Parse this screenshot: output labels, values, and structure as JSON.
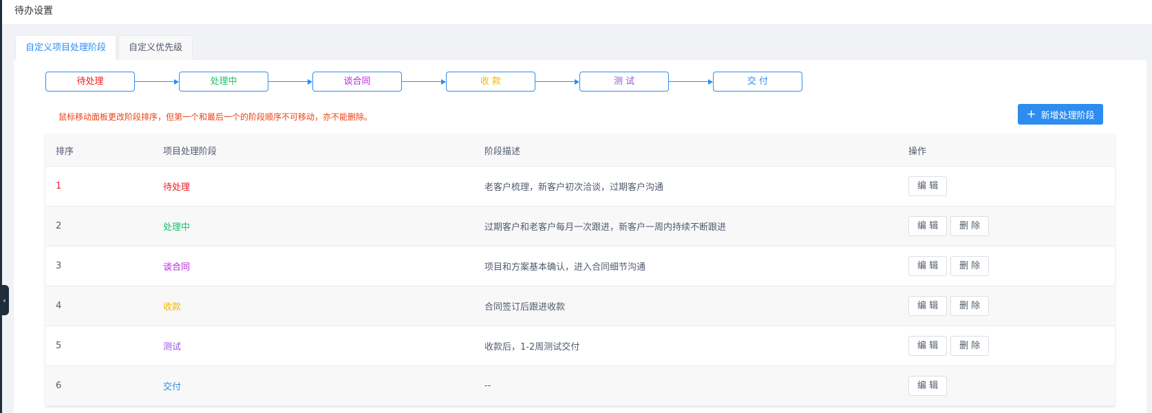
{
  "header": {
    "title": "待办设置"
  },
  "tabs": [
    {
      "label": "自定义项目处理阶段",
      "active": true
    },
    {
      "label": "自定义优先级",
      "active": false
    }
  ],
  "flow": [
    {
      "label": "待处理",
      "color": "#ed1c24"
    },
    {
      "label": "处理中",
      "color": "#19be6b"
    },
    {
      "label": "谈合同",
      "color": "#b620e0"
    },
    {
      "label": "收 款",
      "color": "#f7b500"
    },
    {
      "label": "测 试",
      "color": "#9254de"
    },
    {
      "label": "交 付",
      "color": "#2d8cf0"
    }
  ],
  "hint": "鼠标移动面板更改阶段排序，但第一个和最后一个的阶段顺序不可移动，亦不能删除。",
  "add_button": {
    "label": "新增处理阶段",
    "icon": "plus-icon"
  },
  "table": {
    "columns": [
      "排序",
      "项目处理阶段",
      "阶段描述",
      "操作"
    ],
    "rows": [
      {
        "order": "1",
        "stage": "待处理",
        "color": "#ed1c24",
        "desc": "老客户梳理，新客户初次洽谈，过期客户沟通",
        "edit": "编 辑",
        "delete": ""
      },
      {
        "order": "2",
        "stage": "处理中",
        "color": "#19be6b",
        "desc": "过期客户和老客户每月一次跟进，新客户一周内持续不断跟进",
        "edit": "编 辑",
        "delete": "删 除"
      },
      {
        "order": "3",
        "stage": "谈合同",
        "color": "#b620e0",
        "desc": "项目和方案基本确认，进入合同细节沟通",
        "edit": "编 辑",
        "delete": "删 除"
      },
      {
        "order": "4",
        "stage": "收款",
        "color": "#f7b500",
        "desc": "合同签订后跟进收款",
        "edit": "编 辑",
        "delete": "删 除"
      },
      {
        "order": "5",
        "stage": "测试",
        "color": "#9254de",
        "desc": "收款后，1-2周测试交付",
        "edit": "编 辑",
        "delete": "删 除"
      },
      {
        "order": "6",
        "stage": "交付",
        "color": "#2d8cf0",
        "desc": "--",
        "edit": "编 辑",
        "delete": ""
      }
    ]
  },
  "sidebar_toggle": {
    "icon": "chevron-left-icon",
    "glyph": "‹"
  }
}
